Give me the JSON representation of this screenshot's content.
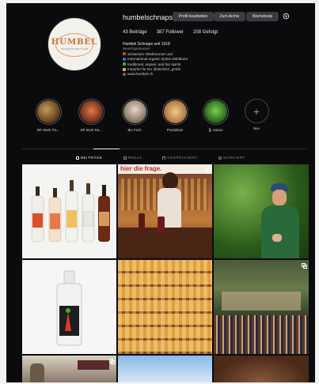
{
  "profile": {
    "username": "humbelschnaps",
    "logo_text": "HUMBEL",
    "logo_subtext": "SCHNAPS SEIT 1918",
    "buttons": {
      "edit": "Profil bearbeiten",
      "archive": "Zum Archiv",
      "ads": "Werbetools"
    },
    "stats": {
      "posts": "43 Beiträge",
      "followers": "387 Follower",
      "following": "208 Gefolgt"
    },
    "bio": {
      "name": "Humbel Schnaps seit 1918",
      "category": "Wein/Spirituosen",
      "lines": [
        "Schweizer Obstbrenner und",
        "International organic spirits distributor",
        "traditional, organic and fair spirits",
        "Importer for EU @dschinn_gmbh"
      ],
      "website": "www.humbel.ch"
    }
  },
  "highlights": [
    {
      "label": "5th Stork Tra...",
      "color": "#8a6a3a"
    },
    {
      "label": "4th Stork Ra...",
      "color": "#a24a2a"
    },
    {
      "label": "Bio Fach",
      "color": "#9a8a7a"
    },
    {
      "label": "Produktion",
      "color": "#c9a06a"
    },
    {
      "label": "🍃 saison",
      "color": "#3a8a2a"
    },
    {
      "label": "Neu",
      "icon": "plus-icon"
    }
  ],
  "tabs": [
    {
      "label": "BEITRÄGE",
      "icon": "grid-icon",
      "active": true
    },
    {
      "label": "REELS",
      "icon": "reels-icon",
      "active": false
    },
    {
      "label": "GESPEICHERT",
      "icon": "bookmark-icon",
      "active": false
    },
    {
      "label": "MARKIERT",
      "icon": "tag-icon",
      "active": false
    }
  ],
  "posts": [
    {
      "desc": "bottle-lineup"
    },
    {
      "desc": "bar-woman",
      "text": "hier die frage."
    },
    {
      "desc": "farmer-in-orchard"
    },
    {
      "desc": "gin-bottle"
    },
    {
      "desc": "shelves-of-bottles"
    },
    {
      "desc": "crowd-under-trees"
    },
    {
      "desc": "store-front"
    },
    {
      "desc": "sky"
    },
    {
      "desc": "barrel"
    }
  ]
}
